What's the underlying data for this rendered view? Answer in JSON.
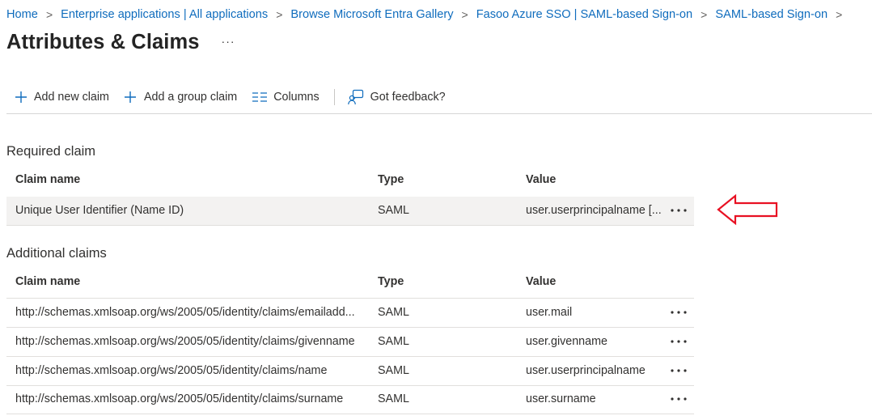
{
  "breadcrumb": [
    "Home",
    "Enterprise applications | All applications",
    "Browse Microsoft Entra Gallery",
    "Fasoo Azure SSO | SAML-based Sign-on",
    "SAML-based Sign-on"
  ],
  "page": {
    "title": "Attributes & Claims",
    "more": "···"
  },
  "toolbar": {
    "add_claim": "Add new claim",
    "add_group_claim": "Add a group claim",
    "columns": "Columns",
    "feedback": "Got feedback?"
  },
  "required": {
    "heading": "Required claim",
    "columns": {
      "name": "Claim name",
      "type": "Type",
      "value": "Value"
    },
    "rows": [
      {
        "name": "Unique User Identifier (Name ID)",
        "type": "SAML",
        "value": "user.userprincipalname [..."
      }
    ]
  },
  "additional": {
    "heading": "Additional claims",
    "columns": {
      "name": "Claim name",
      "type": "Type",
      "value": "Value"
    },
    "rows": [
      {
        "name": "http://schemas.xmlsoap.org/ws/2005/05/identity/claims/emailadd...",
        "type": "SAML",
        "value": "user.mail"
      },
      {
        "name": "http://schemas.xmlsoap.org/ws/2005/05/identity/claims/givenname",
        "type": "SAML",
        "value": "user.givenname"
      },
      {
        "name": "http://schemas.xmlsoap.org/ws/2005/05/identity/claims/name",
        "type": "SAML",
        "value": "user.userprincipalname"
      },
      {
        "name": "http://schemas.xmlsoap.org/ws/2005/05/identity/claims/surname",
        "type": "SAML",
        "value": "user.surname"
      }
    ]
  },
  "colors": {
    "link": "#0f6cbd",
    "accent_icon": "#0f6cbd",
    "annotation_arrow": "#e81123",
    "selected_row": "#f3f2f1"
  }
}
